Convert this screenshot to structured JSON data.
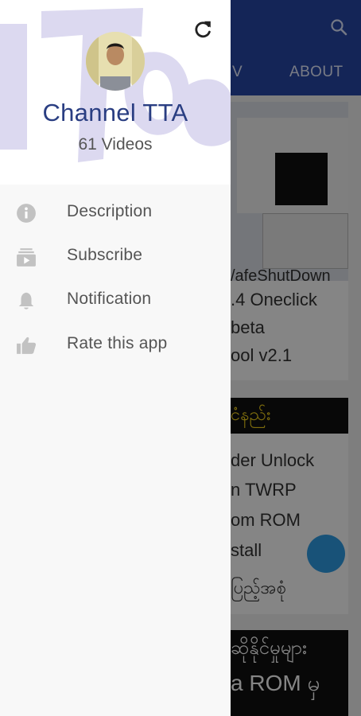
{
  "background_app": {
    "tabs": [
      "V",
      "ABOUT"
    ],
    "cards": [
      {
        "lines": [
          "/afeShutDown",
          ".4 Oneclick",
          "beta",
          "ool v2.1"
        ]
      },
      {
        "banner": "ငံနည်း",
        "lines": [
          "der Unlock",
          "n TWRP",
          "om ROM",
          "stall",
          "ပြည့်အစုံ"
        ]
      },
      {
        "lines": [
          "ဆိုနိုင်မှုများ",
          "a ROM မှ"
        ]
      }
    ]
  },
  "drawer": {
    "header": {
      "channel_name": "Channel TTA",
      "video_count": "61 Videos"
    },
    "menu": [
      {
        "label": "Description",
        "icon": "info-icon"
      },
      {
        "label": "Subscribe",
        "icon": "subscriptions-icon"
      },
      {
        "label": "Notification",
        "icon": "bell-icon"
      },
      {
        "label": "Rate this app",
        "icon": "thumbs-up-icon"
      }
    ]
  },
  "colors": {
    "appbar": "#2748a8",
    "channel_name": "#2a3e82",
    "icon_gray": "#bdbdbd"
  }
}
